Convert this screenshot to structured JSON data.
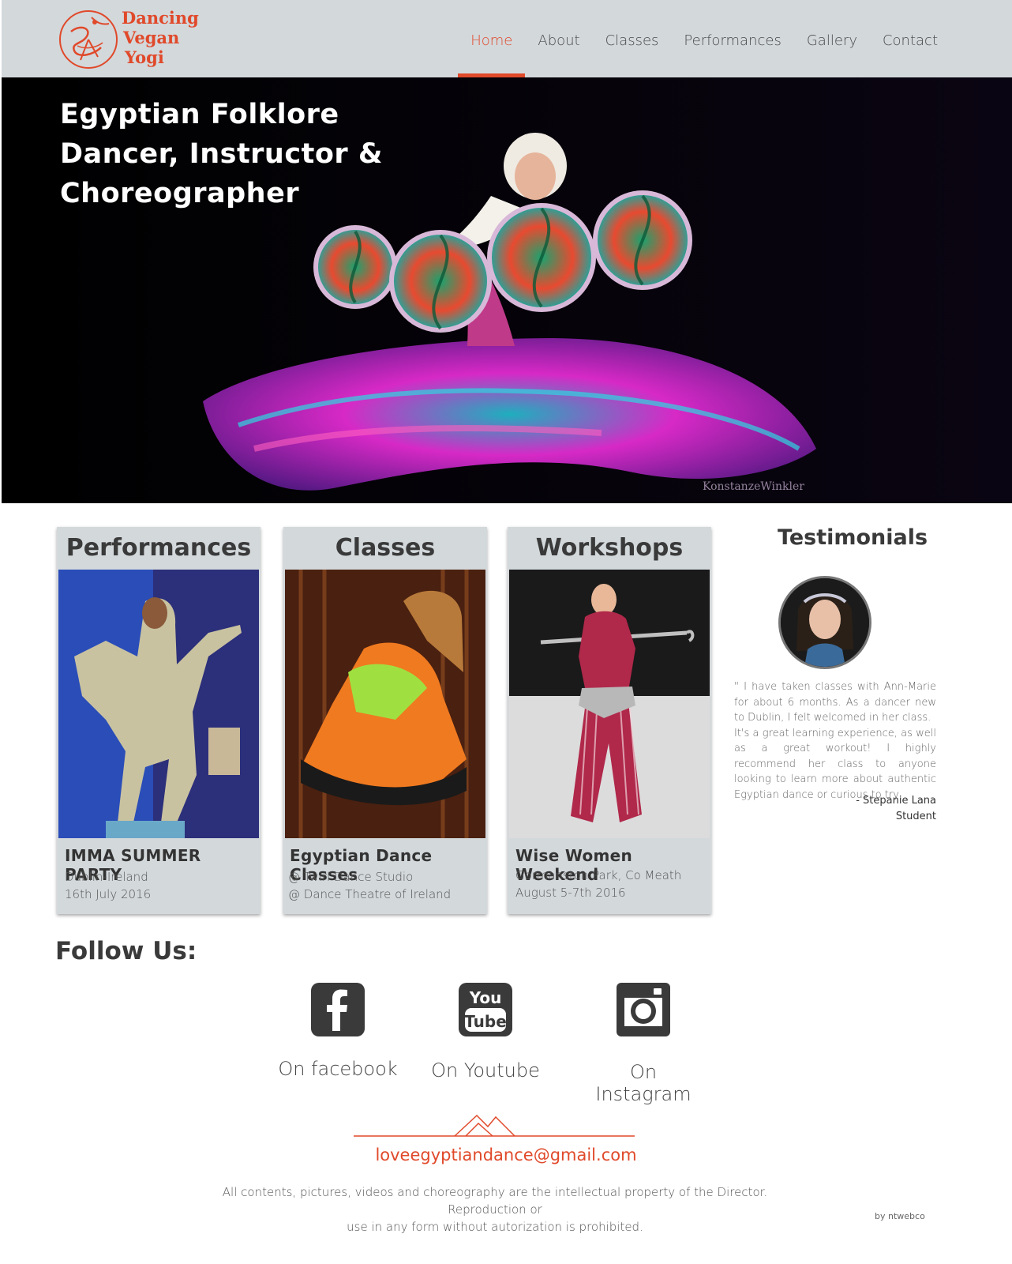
{
  "brand": {
    "logo_line1": "Dancing",
    "logo_line2": "Vegan",
    "logo_line3": "Yogi",
    "accent_color": "#e0492a",
    "header_bg": "#d3d8db"
  },
  "nav": {
    "items": [
      {
        "label": "Home",
        "active": true
      },
      {
        "label": "About",
        "active": false
      },
      {
        "label": "Classes",
        "active": false
      },
      {
        "label": "Performances",
        "active": false
      },
      {
        "label": "Gallery",
        "active": false
      },
      {
        "label": "Contact",
        "active": false
      }
    ]
  },
  "hero": {
    "title_line1": "Egyptian Folklore",
    "title_line2": "Dancer, Instructor &",
    "title_line3": "Choreographer",
    "photo_credit": "KonstanzeWinkler"
  },
  "cards": [
    {
      "heading": "Performances",
      "title": "IMMA SUMMER PARTY",
      "line1": "Dublin-Ireland",
      "line2": "16th July 2016"
    },
    {
      "heading": "Classes",
      "title": "Egyptian Dance Classes",
      "line1": "@ Twirl Dance Studio",
      "line2": "@ Dance Theatre of Ireland"
    },
    {
      "heading": "Workshops",
      "title": "Wise Women Weekend",
      "line1": "Gormanston Park, Co Meath",
      "line2": "August 5-7th 2016"
    }
  ],
  "testimonials": {
    "title": "Testimonials",
    "quote_p1": "\" I have taken classes with Ann-Marie for about 6 months. As a dancer new to Dublin, I felt welcomed in her class.",
    "quote_p2": "It's a great learning experience, as well as a great workout! I highly recommend her class to anyone looking to learn more about authentic Egyptian dance or curious to try",
    "author": "- Stepanie Lana",
    "role": "Student"
  },
  "follow": {
    "title": "Follow Us:",
    "facebook_label": "On facebook",
    "youtube_label": "On Youtube",
    "instagram_label": "On Instagram",
    "youtube_icon_top": "You",
    "youtube_icon_bottom": "Tube"
  },
  "footer": {
    "email": "loveegyptiandance@gmail.com",
    "note_line1": "All contents, pictures, videos and choreography are the intellectual property of the Director. Reproduction or",
    "note_line2": "use in any form without autorization is prohibited.",
    "by": "by ntwebco"
  }
}
